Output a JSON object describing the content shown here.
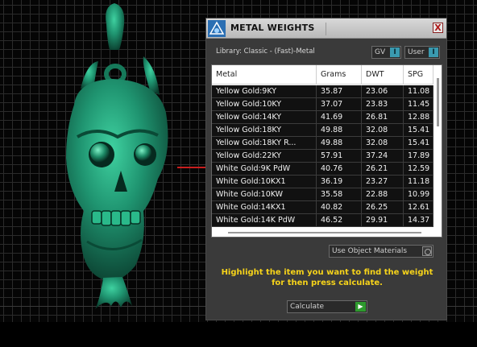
{
  "viewport": {
    "description_icon": "skull-pendant-model"
  },
  "panel": {
    "title": "METAL WEIGHTS",
    "close_glyph": "X",
    "library_label": "Library: Classic - (Fast)-Metal",
    "toggles": [
      {
        "label": "GV",
        "knob": "I"
      },
      {
        "label": "User",
        "knob": "I"
      }
    ],
    "table": {
      "columns": [
        "Metal",
        "Grams",
        "DWT",
        "SPG"
      ],
      "rows": [
        [
          "Yellow Gold:9KY",
          "35.87",
          "23.06",
          "11.08"
        ],
        [
          "Yellow Gold:10KY",
          "37.07",
          "23.83",
          "11.45"
        ],
        [
          "Yellow Gold:14KY",
          "41.69",
          "26.81",
          "12.88"
        ],
        [
          "Yellow Gold:18KY",
          "49.88",
          "32.08",
          "15.41"
        ],
        [
          "Yellow Gold:18KY R...",
          "49.88",
          "32.08",
          "15.41"
        ],
        [
          "Yellow Gold:22KY",
          "57.91",
          "37.24",
          "17.89"
        ],
        [
          "White Gold:9K PdW",
          "40.76",
          "26.21",
          "12.59"
        ],
        [
          "White Gold:10KX1",
          "36.19",
          "23.27",
          "11.18"
        ],
        [
          "White Gold:10KW",
          "35.58",
          "22.88",
          "10.99"
        ],
        [
          "White Gold:14KX1",
          "40.82",
          "26.25",
          "12.61"
        ],
        [
          "White Gold:14K PdW",
          "46.52",
          "29.91",
          "14.37"
        ]
      ]
    },
    "use_object_materials": "Use Object Materials",
    "instructions": "Highlight the item you want to find the weight for then press calculate.",
    "calculate_label": "Calculate",
    "colors": {
      "highlight_text": "#f6d31a",
      "toggle_on": "#3a9ab0",
      "calculate_play": "#2e9a2e",
      "model": "#1f8a66"
    }
  }
}
